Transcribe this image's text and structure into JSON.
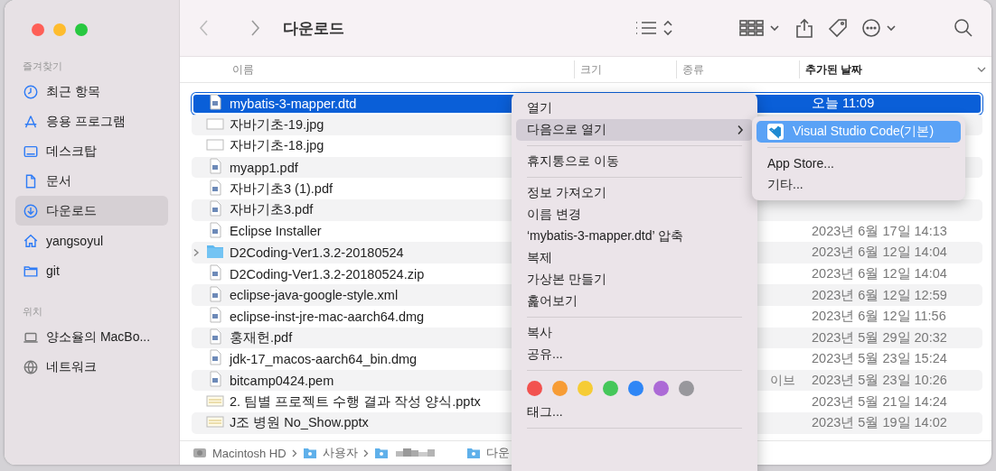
{
  "window": {
    "title": "다운로드"
  },
  "sidebar": {
    "sections": [
      {
        "heading": "즐겨찾기",
        "items": [
          {
            "label": "최근 항목",
            "kind": "clock",
            "selected": false
          },
          {
            "label": "응용 프로그램",
            "kind": "apps",
            "selected": false
          },
          {
            "label": "데스크탑",
            "kind": "desktop",
            "selected": false
          },
          {
            "label": "문서",
            "kind": "document",
            "selected": false
          },
          {
            "label": "다운로드",
            "kind": "download",
            "selected": true
          },
          {
            "label": "yangsoyul",
            "kind": "home",
            "selected": false
          },
          {
            "label": "git",
            "kind": "folder",
            "selected": false
          }
        ]
      },
      {
        "heading": "위치",
        "items": [
          {
            "label": "양소율의 MacBo...",
            "kind": "laptop",
            "selected": false
          },
          {
            "label": "네트워크",
            "kind": "network",
            "selected": false
          }
        ]
      }
    ]
  },
  "table": {
    "columns": [
      "이름",
      "크기",
      "종류",
      "추가된 날짜"
    ],
    "rows": [
      {
        "name": "mybatis-3-mapper.dtd",
        "kind": "file",
        "date": "오늘 11:09",
        "selected": true
      },
      {
        "name": "자바기초-19.jpg",
        "kind": "image",
        "selected": false
      },
      {
        "name": "자바기초-18.jpg",
        "kind": "image",
        "selected": false
      },
      {
        "name": "myapp1.pdf",
        "kind": "file",
        "selected": false
      },
      {
        "name": "자바기초3 (1).pdf",
        "kind": "file",
        "selected": false
      },
      {
        "name": "자바기초3.pdf",
        "kind": "file",
        "selected": false
      },
      {
        "name": "Eclipse Installer",
        "kind": "file",
        "date": "2023년 6월 17일 14:13",
        "selected": false
      },
      {
        "name": "D2Coding-Ver1.3.2-20180524",
        "kind": "folder",
        "date": "2023년 6월 12일 14:04",
        "selected": false
      },
      {
        "name": "D2Coding-Ver1.3.2-20180524.zip",
        "kind": "file",
        "date": "2023년 6월 12일 14:04",
        "selected": false
      },
      {
        "name": "eclipse-java-google-style.xml",
        "kind": "file",
        "date": "2023년 6월 12일 12:59",
        "selected": false
      },
      {
        "name": "eclipse-inst-jre-mac-aarch64.dmg",
        "kind": "file",
        "date": "2023년 6월 12일 11:56",
        "selected": false
      },
      {
        "name": "홍재헌.pdf",
        "kind": "file",
        "date": "2023년 5월 29일 20:32",
        "selected": false
      },
      {
        "name": "jdk-17_macos-aarch64_bin.dmg",
        "kind": "file",
        "date": "2023년 5월 23일 15:24",
        "selected": false
      },
      {
        "name": "bitcamp0424.pem",
        "kind": "file",
        "type": "이브",
        "date": "2023년 5월 23일 10:26",
        "selected": false
      },
      {
        "name": "2. 팀별 프로젝트 수행 결과 작성 양식.pptx",
        "kind": "slides",
        "date": "2023년 5월 21일 14:24",
        "selected": false
      },
      {
        "name": "J조 병원 No_Show.pptx",
        "kind": "slides",
        "date": "2023년 5월 19일 14:02",
        "selected": false
      }
    ]
  },
  "path_bar": [
    "Macintosh HD",
    "사용자",
    "다운"
  ],
  "context_menu": [
    {
      "kind": "item",
      "label": "열기",
      "selected": false
    },
    {
      "kind": "submenu",
      "label": "다음으로 열기",
      "selected": true
    },
    {
      "kind": "separator"
    },
    {
      "kind": "item",
      "label": "휴지통으로 이동",
      "selected": false
    },
    {
      "kind": "separator"
    },
    {
      "kind": "item",
      "label": "정보 가져오기",
      "selected": false
    },
    {
      "kind": "item",
      "label": "이름 변경",
      "selected": false
    },
    {
      "kind": "item",
      "label": "‘mybatis-3-mapper.dtd’ 압축",
      "selected": false
    },
    {
      "kind": "item",
      "label": "복제",
      "selected": false
    },
    {
      "kind": "item",
      "label": "가상본 만들기",
      "selected": false
    },
    {
      "kind": "item",
      "label": "훑어보기",
      "selected": false
    },
    {
      "kind": "separator"
    },
    {
      "kind": "item",
      "label": "복사",
      "selected": false
    },
    {
      "kind": "item",
      "label": "공유...",
      "selected": false
    },
    {
      "kind": "separator"
    },
    {
      "kind": "colors",
      "colors": [
        {
          "color": "#f2524f"
        },
        {
          "color": "#f79c35"
        },
        {
          "color": "#f6cc35"
        },
        {
          "color": "#45c75a"
        },
        {
          "color": "#2f86f6"
        },
        {
          "color": "#ac6ad6"
        },
        {
          "color": "#98979c"
        }
      ]
    },
    {
      "kind": "item",
      "label": "태그...",
      "selected": false
    },
    {
      "kind": "separator"
    }
  ],
  "submenu": [
    {
      "kind": "app",
      "label": "Visual Studio Code(기본)",
      "selected": true
    },
    {
      "kind": "separator"
    },
    {
      "kind": "item",
      "label": "App Store...",
      "selected": false
    },
    {
      "kind": "item",
      "label": "기타...",
      "selected": false
    }
  ]
}
